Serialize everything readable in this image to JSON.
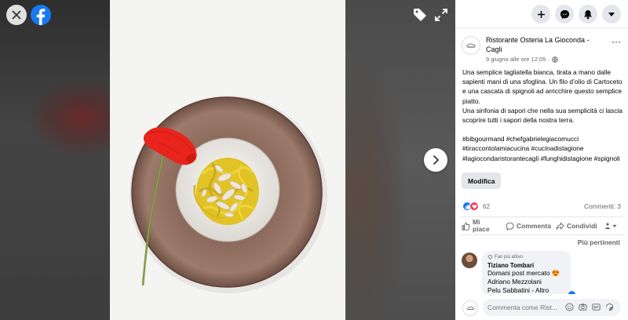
{
  "viewer": {
    "icons": {
      "close": "close-icon",
      "facebook": "facebook-logo",
      "tag": "tag-icon",
      "fullscreen": "fullscreen-icon",
      "next": "chevron-right-icon"
    }
  },
  "topbar": {
    "icons": [
      "plus-icon",
      "messenger-icon",
      "notifications-icon",
      "caret-down-icon"
    ]
  },
  "post": {
    "page_name": "Ristorante Osteria La Gioconda - Cagli",
    "time": "9 giugno alle ore 12:05 ·",
    "more_label": "···",
    "body": "Una semplice tagliatella bianca, tirata a mano dalle sapienti mani di una sfoglina. Un filo d’olio di Cartoceto e una cascata di spignoli ad arricchire questo semplice piatto.\nUna sinfonia di sapori che nella sua semplicità ci lascia scoprire tutti i sapori della nostra terra.",
    "hashtags": [
      "#bibgourmand",
      "#chefgabrielegiacomucci",
      "#tiraccontolamiacucina",
      "#cucinadistagione",
      "#lagiocondaristorantecagli",
      "#funghidistagione",
      "#spignoli"
    ],
    "edit_button": "Modifica",
    "reactions": {
      "count": "62",
      "types": [
        "like",
        "love"
      ]
    },
    "comments_count": "Commenti: 3",
    "actions": {
      "like": "Mi piace",
      "comment": "Commenta",
      "share": "Condividi"
    },
    "sort_label": "Più pertinenti"
  },
  "comment": {
    "badge": "Fan più attivo",
    "author": "Tiziano Tombari",
    "text": "Domani post mercato 😍\nAdriano Mezzolani\nPelu Sabbatini - Altro"
  },
  "composer": {
    "placeholder": "Commenta come Rist..."
  },
  "colors": {
    "facebook_blue": "#1877f2",
    "panel_bg": "#ffffff",
    "secondary_text": "#65676b",
    "chip_bg": "#e4e6eb"
  }
}
